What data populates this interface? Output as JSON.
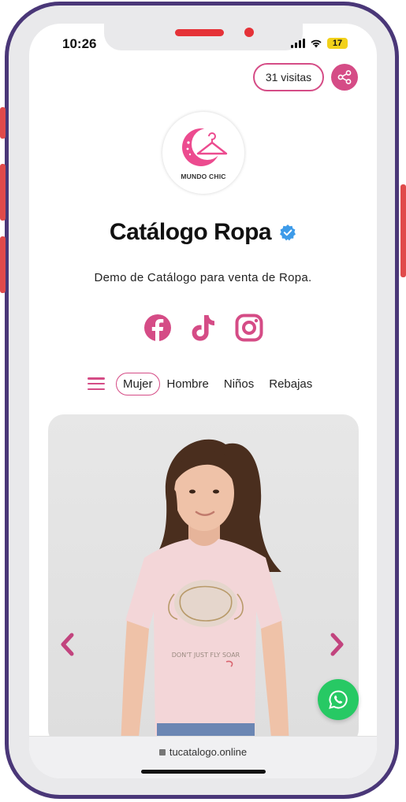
{
  "status": {
    "time": "10:26",
    "battery": "17"
  },
  "header": {
    "visits": "31 visitas"
  },
  "logo": {
    "text": "MUNDO CHIC"
  },
  "profile": {
    "title": "Catálogo Ropa",
    "description": "Demo de Catálogo para venta de Ropa."
  },
  "socials": [
    "facebook-icon",
    "tiktok-icon",
    "instagram-icon"
  ],
  "nav": {
    "items": [
      {
        "label": "Mujer",
        "active": true
      },
      {
        "label": "Hombre"
      },
      {
        "label": "Niños"
      },
      {
        "label": "Rebajas"
      }
    ]
  },
  "product": {
    "print_text": "DON'T JUST FLY SOAR"
  },
  "browser": {
    "url": "tucatalogo.online"
  },
  "colors": {
    "accent": "#d54c86",
    "frame": "#4a3778",
    "whatsapp": "#27c964",
    "verified": "#3d9be9"
  }
}
